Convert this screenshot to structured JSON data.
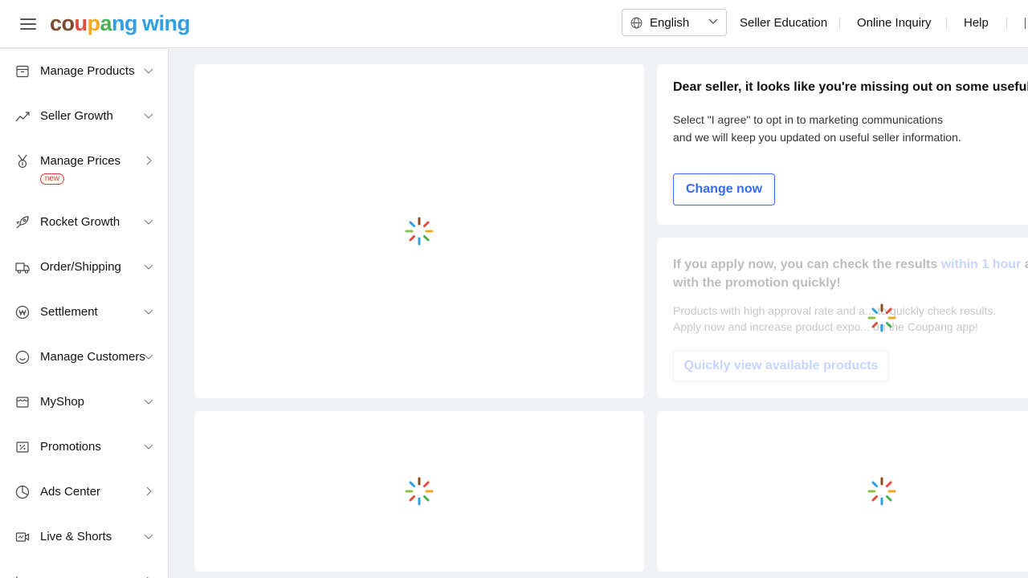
{
  "header": {
    "logo": {
      "co": "co",
      "u": "u",
      "p": "p",
      "a": "a",
      "ng": "ng",
      "wing": "wing"
    },
    "language": {
      "selected": "English"
    },
    "nav": [
      "Seller Education",
      "Online Inquiry",
      "Help"
    ]
  },
  "sidebar": {
    "items": [
      {
        "label": "Manage Products",
        "icon": "box-icon",
        "chevron": "down"
      },
      {
        "label": "Seller Growth",
        "icon": "growth-chart-icon",
        "chevron": "down"
      },
      {
        "label": "Manage Prices",
        "icon": "medal-icon",
        "chevron": "right",
        "badge": "new"
      },
      {
        "label": "Rocket Growth",
        "icon": "rocket-icon",
        "chevron": "down"
      },
      {
        "label": "Order/Shipping",
        "icon": "truck-icon",
        "chevron": "down"
      },
      {
        "label": "Settlement",
        "icon": "won-coin-icon",
        "chevron": "down"
      },
      {
        "label": "Manage Customers",
        "icon": "smiley-icon",
        "chevron": "down"
      },
      {
        "label": "MyShop",
        "icon": "shop-icon",
        "chevron": "down"
      },
      {
        "label": "Promotions",
        "icon": "coupon-icon",
        "chevron": "down"
      },
      {
        "label": "Ads Center",
        "icon": "pie-chart-icon",
        "chevron": "right"
      },
      {
        "label": "Live & Shorts",
        "icon": "video-icon",
        "chevron": "down"
      }
    ]
  },
  "marketing_card": {
    "title": "Dear seller, it looks like you're missing out on some useful in",
    "line1": "Select \"I agree\" to opt in to marketing communications",
    "line2": "and we will keep you updated on useful seller information.",
    "button": "Change now"
  },
  "apply_card": {
    "title_prefix": "If you apply now, you can check the results ",
    "title_highlight": "within 1 hour",
    "title_suffix": " and",
    "title_line2": "with the promotion quickly!",
    "line1": "Products with high approval rate and a... to quickly check results.",
    "line2": "Apply now and increase product expo... on the Coupang app!",
    "button": "Quickly view available products"
  },
  "colors": {
    "accent": "#346aff",
    "badge": "#e0362c",
    "background": "#f0f1f5"
  }
}
